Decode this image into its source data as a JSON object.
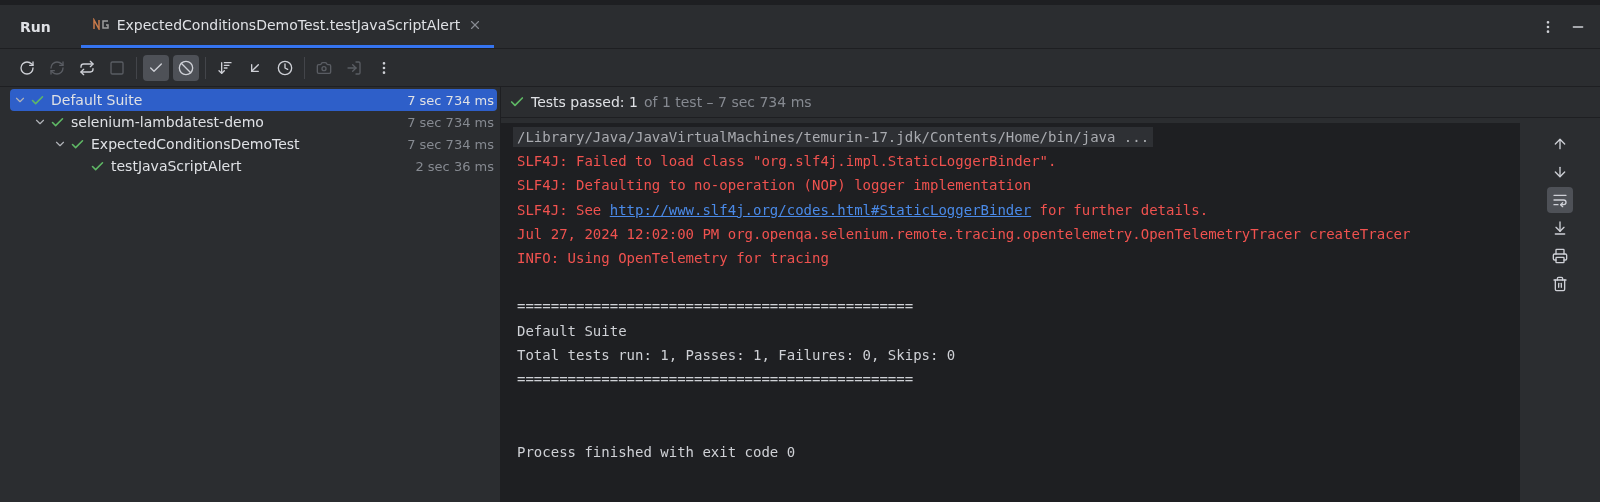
{
  "header": {
    "title": "Run",
    "tab": {
      "label": "ExpectedConditionsDemoTest.testJavaScriptAlert",
      "selected": true
    }
  },
  "toolbar": [
    {
      "kind": "rerun",
      "disabled": false,
      "on": false
    },
    {
      "kind": "rerun-failed",
      "disabled": true,
      "on": false
    },
    {
      "kind": "auto-test",
      "disabled": false,
      "on": false
    },
    {
      "kind": "stop",
      "disabled": true,
      "on": false
    },
    {
      "kind": "divider"
    },
    {
      "kind": "show-passed",
      "disabled": false,
      "on": true
    },
    {
      "kind": "show-ignored",
      "disabled": false,
      "on": true
    },
    {
      "kind": "divider"
    },
    {
      "kind": "sort",
      "disabled": false,
      "on": false
    },
    {
      "kind": "import",
      "disabled": false,
      "on": false
    },
    {
      "kind": "history",
      "disabled": false,
      "on": false
    },
    {
      "kind": "divider"
    },
    {
      "kind": "screenshot",
      "disabled": true,
      "on": false
    },
    {
      "kind": "export",
      "disabled": true,
      "on": false
    },
    {
      "kind": "more",
      "disabled": false,
      "on": false
    }
  ],
  "tree": [
    {
      "name": "Default Suite",
      "time": "7 sec 734 ms",
      "selected": true,
      "expanded": true,
      "passed": true,
      "children": [
        {
          "name": "selenium-lambdatest-demo",
          "time": "7 sec 734 ms",
          "selected": false,
          "expanded": true,
          "passed": true,
          "children": [
            {
              "name": "ExpectedConditionsDemoTest",
              "time": "7 sec 734 ms",
              "selected": false,
              "expanded": true,
              "passed": true,
              "children": [
                {
                  "name": "testJavaScriptAlert",
                  "time": "2 sec 36 ms",
                  "selected": false,
                  "passed": true
                }
              ]
            }
          ]
        }
      ]
    }
  ],
  "status": {
    "passed": true,
    "label": "Tests passed: 1",
    "detail": "of 1 test – 7 sec 734 ms"
  },
  "console": [
    {
      "kind": "command",
      "parts": [
        {
          "text": "/Library/Java/JavaVirtualMachines/temurin-17.jdk/Contents/Home/bin/java ...",
          "kind": "text"
        }
      ]
    },
    {
      "kind": "error",
      "parts": [
        {
          "text": "SLF4J: Failed to load class \"org.slf4j.impl.StaticLoggerBinder\".",
          "kind": "text"
        }
      ]
    },
    {
      "kind": "error",
      "parts": [
        {
          "text": "SLF4J: Defaulting to no-operation (NOP) logger implementation",
          "kind": "text"
        }
      ]
    },
    {
      "kind": "error",
      "parts": [
        {
          "text": "SLF4J: See ",
          "kind": "text"
        },
        {
          "text": "http://www.slf4j.org/codes.html#StaticLoggerBinder",
          "kind": "link"
        },
        {
          "text": " for further details.",
          "kind": "text"
        }
      ]
    },
    {
      "kind": "error",
      "parts": [
        {
          "text": "Jul 27, 2024 12:02:00 PM org.openqa.selenium.remote.tracing.opentelemetry.OpenTelemetryTracer createTracer",
          "kind": "text"
        }
      ]
    },
    {
      "kind": "error",
      "parts": [
        {
          "text": "INFO: Using OpenTelemetry for tracing",
          "kind": "text"
        }
      ]
    },
    {
      "kind": "blank"
    },
    {
      "kind": "output",
      "parts": [
        {
          "text": "===============================================",
          "kind": "text"
        }
      ]
    },
    {
      "kind": "output",
      "parts": [
        {
          "text": "Default Suite",
          "kind": "text"
        }
      ]
    },
    {
      "kind": "output",
      "parts": [
        {
          "text": "Total tests run: 1, Passes: 1, Failures: 0, Skips: 0",
          "kind": "text"
        }
      ]
    },
    {
      "kind": "output",
      "parts": [
        {
          "text": "===============================================",
          "kind": "text"
        }
      ]
    },
    {
      "kind": "blank"
    },
    {
      "kind": "blank"
    },
    {
      "kind": "output",
      "parts": [
        {
          "text": "Process finished with exit code 0",
          "kind": "text"
        }
      ]
    }
  ],
  "side_tools": [
    {
      "kind": "up",
      "on": false
    },
    {
      "kind": "down",
      "on": false
    },
    {
      "kind": "wrap",
      "on": true
    },
    {
      "kind": "scroll-end",
      "on": false
    },
    {
      "kind": "print",
      "on": false
    },
    {
      "kind": "clear",
      "on": false
    }
  ]
}
